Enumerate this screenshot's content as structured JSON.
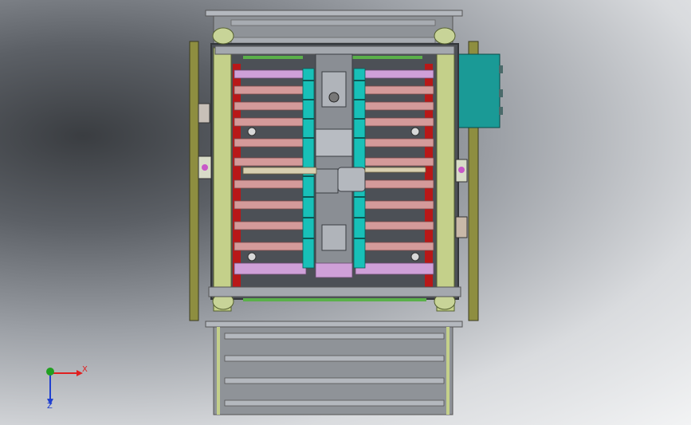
{
  "triad": {
    "x_label": "X",
    "z_label": "Z",
    "x_color": "#e02020",
    "y_color": "#20a020",
    "z_color": "#2040d0"
  },
  "colors": {
    "frame": "#6c7076",
    "frame_light": "#a4a8ae",
    "roller_pink": "#d49a9a",
    "roller_violet": "#cfa0d8",
    "roller_grey": "#a8acb2",
    "accent_cyan": "#18c0b8",
    "accent_red": "#b81818",
    "guide_green": "#8aa060",
    "rail_olive": "#9a9a3a",
    "motor_box": "#1a9a96"
  }
}
